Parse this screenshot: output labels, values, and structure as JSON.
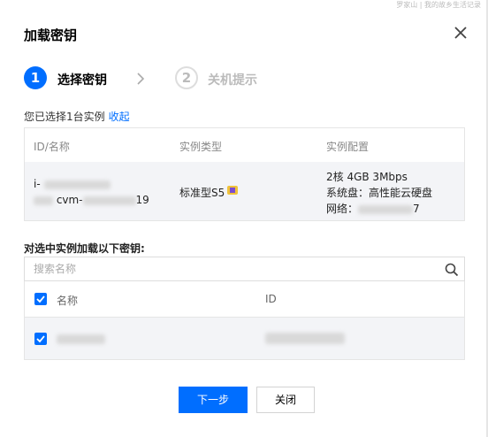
{
  "watermark": "罗家山 | 我的故乡生活记录",
  "dialog": {
    "title": "加载密钥",
    "close_icon": "close-icon"
  },
  "steps": [
    {
      "number": "1",
      "label": "选择密钥",
      "active": true
    },
    {
      "number": "2",
      "label": "关机提示",
      "active": false
    }
  ],
  "selection": {
    "text": "您已选择1台实例",
    "toggle_label": "收起"
  },
  "instances": {
    "columns": [
      "ID/名称",
      "实例类型",
      "实例配置"
    ],
    "rows": [
      {
        "id_prefix": "i-",
        "name_prefix": "",
        "name_middle": "cvm-",
        "name_suffix": "19",
        "type": "标准型S5",
        "config": [
          "2核 4GB 3Mbps",
          "系统盘：高性能云硬盘",
          "网络："
        ],
        "network_suffix": "7"
      }
    ]
  },
  "key_section": {
    "title": "对选中实例加载以下密钥:",
    "search_placeholder": "搜索名称",
    "columns": [
      "名称",
      "ID"
    ]
  },
  "buttons": {
    "next": "下一步",
    "close": "关闭"
  },
  "colors": {
    "accent": "#006eff",
    "row_bg": "#f3f4f7",
    "border": "#e5e5e5"
  }
}
